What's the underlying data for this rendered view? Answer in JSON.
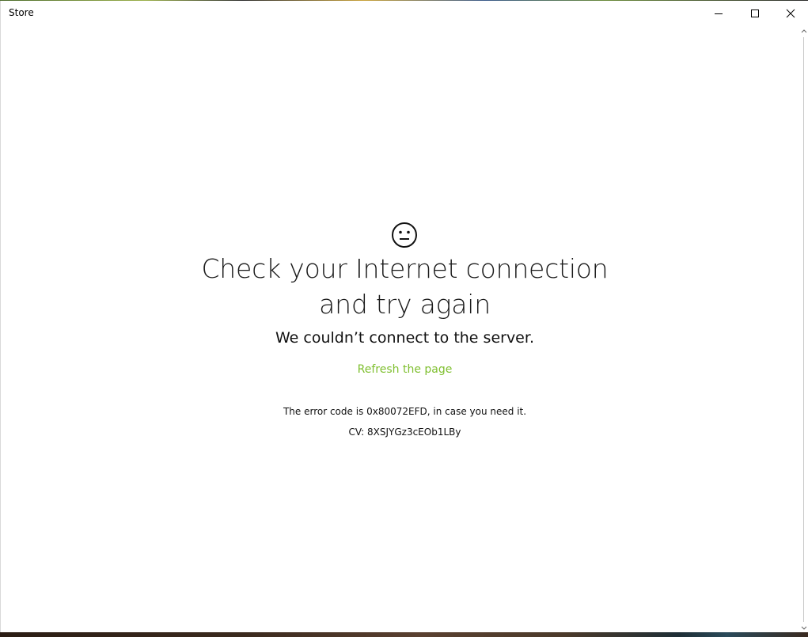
{
  "window": {
    "title": "Store"
  },
  "error": {
    "headline_line1": "Check your Internet connection",
    "headline_line2": "and try again",
    "subheading": "We couldn’t connect to the server.",
    "refresh_link": "Refresh the page",
    "error_code_text": "The error code is 0x80072EFD, in case you need it.",
    "cv_text": "CV: 8XSJYGz3cEOb1LBy"
  },
  "icons": {
    "face": "neutral-face-icon",
    "minimize": "minimize-icon",
    "maximize": "maximize-icon",
    "close": "close-icon"
  },
  "colors": {
    "accent_link": "#7fbf2f",
    "background": "#ffffff",
    "text": "#000000"
  }
}
